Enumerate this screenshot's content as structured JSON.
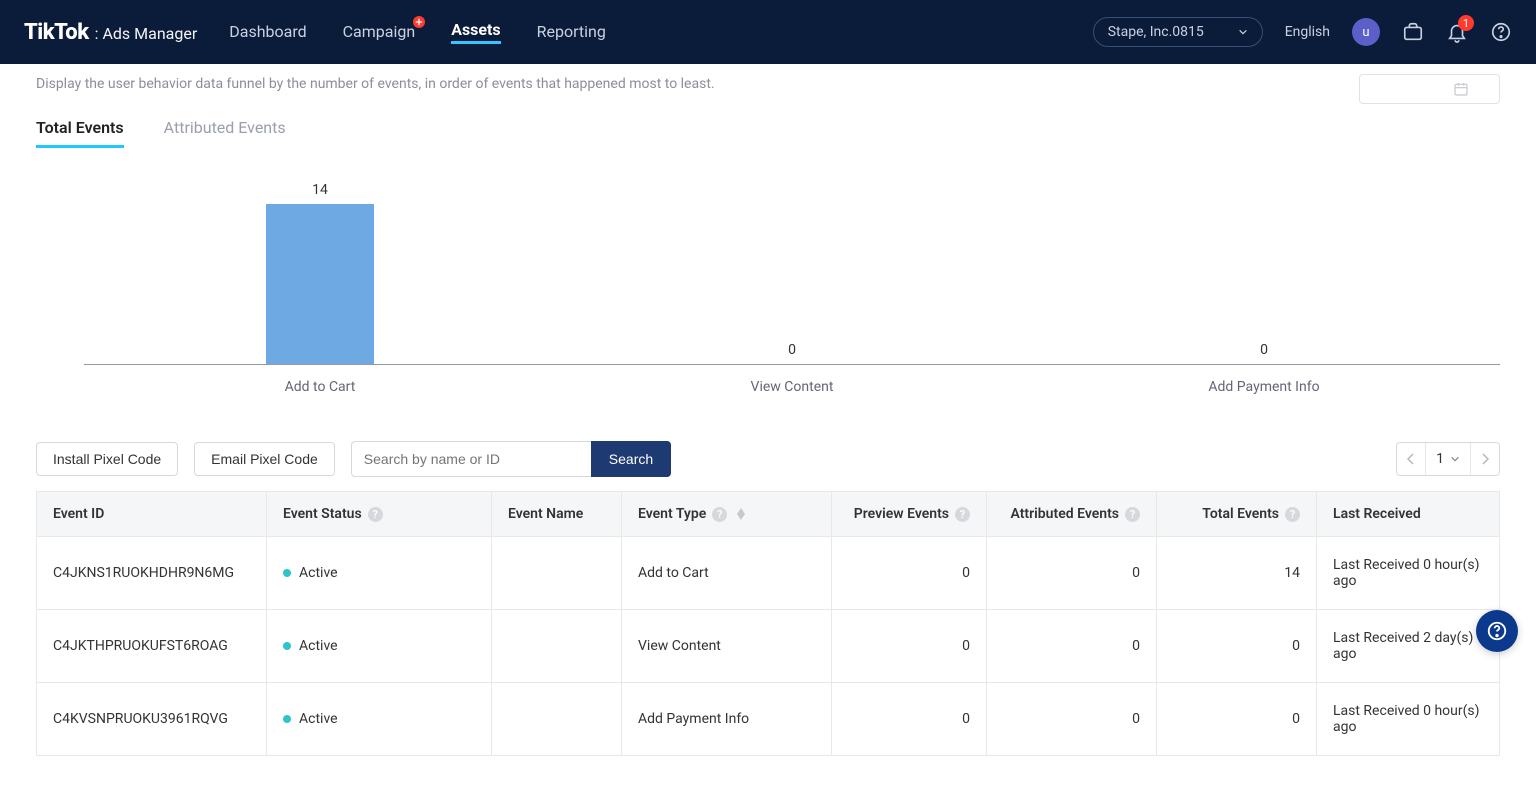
{
  "header": {
    "logo": "TikTok",
    "logo_sub": ": Ads Manager",
    "nav": {
      "dashboard": "Dashboard",
      "campaign": "Campaign",
      "assets": "Assets",
      "reporting": "Reporting"
    },
    "account_name": "Stape, Inc.0815",
    "language": "English",
    "avatar_initial": "u",
    "notif_count": "1"
  },
  "section": {
    "desc": "Display the user behavior data funnel by the number of events, in order of events that happened most to least.",
    "tab_total": "Total Events",
    "tab_attributed": "Attributed Events"
  },
  "chart_data": {
    "type": "bar",
    "categories": [
      "Add to Cart",
      "View Content",
      "Add Payment Info"
    ],
    "values": [
      14,
      0,
      0
    ],
    "xlabel": "",
    "ylabel": "",
    "ylim": [
      0,
      14
    ]
  },
  "toolbar": {
    "install": "Install Pixel Code",
    "email": "Email Pixel Code",
    "search_placeholder": "Search by name or ID",
    "search_btn": "Search",
    "page": "1"
  },
  "table": {
    "headers": {
      "event_id": "Event ID",
      "event_status": "Event Status",
      "event_name": "Event Name",
      "event_type": "Event Type",
      "preview": "Preview Events",
      "attributed": "Attributed Events",
      "total": "Total Events",
      "last_received": "Last Received"
    },
    "rows": [
      {
        "id": "C4JKNS1RUOKHDHR9N6MG",
        "status": "Active",
        "name": "",
        "type": "Add to Cart",
        "preview": "0",
        "attributed": "0",
        "total": "14",
        "last_received": "Last Received 0 hour(s) ago"
      },
      {
        "id": "C4JKTHPRUOKUFST6ROAG",
        "status": "Active",
        "name": "",
        "type": "View Content",
        "preview": "0",
        "attributed": "0",
        "total": "0",
        "last_received": "Last Received 2 day(s) ago"
      },
      {
        "id": "C4KVSNPRUOKU3961RQVG",
        "status": "Active",
        "name": "",
        "type": "Add Payment Info",
        "preview": "0",
        "attributed": "0",
        "total": "0",
        "last_received": "Last Received 0 hour(s) ago"
      }
    ]
  }
}
